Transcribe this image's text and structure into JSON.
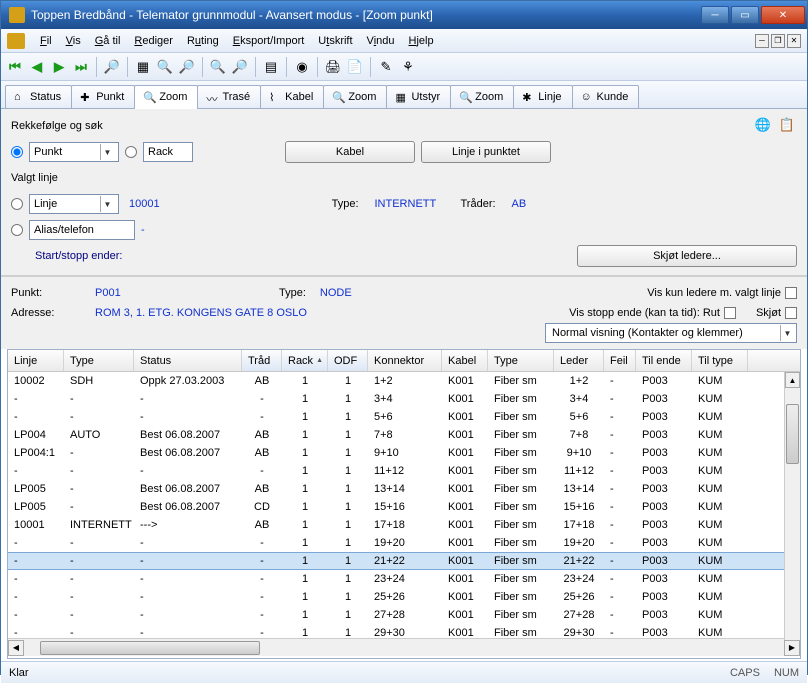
{
  "window": {
    "title": "Toppen Bredbånd - Telemator grunnmodul - Avansert modus - [Zoom punkt]"
  },
  "menu": {
    "fil": "Fil",
    "vis": "Vis",
    "gatil": "Gå til",
    "rediger": "Rediger",
    "ruting": "Ruting",
    "eksport": "Eksport/Import",
    "utskrift": "Utskrift",
    "vindu": "Vindu",
    "hjelp": "Hjelp"
  },
  "tabs": [
    {
      "icon": "home",
      "label": "Status"
    },
    {
      "icon": "plus",
      "label": "Punkt"
    },
    {
      "icon": "zoom",
      "label": "Zoom",
      "active": true
    },
    {
      "icon": "path",
      "label": "Trasé"
    },
    {
      "icon": "cable",
      "label": "Kabel"
    },
    {
      "icon": "zoom",
      "label": "Zoom"
    },
    {
      "icon": "equip",
      "label": "Utstyr"
    },
    {
      "icon": "zoom",
      "label": "Zoom"
    },
    {
      "icon": "line",
      "label": "Linje"
    },
    {
      "icon": "cust",
      "label": "Kunde"
    }
  ],
  "form": {
    "order_label": "Rekkefølge og søk",
    "punkt_opt": "Punkt",
    "rack_opt": "Rack",
    "btn_kabel": "Kabel",
    "btn_linje": "Linje i punktet",
    "valgt_label": "Valgt linje",
    "linje_opt": "Linje",
    "linje_val": "10001",
    "type_label": "Type:",
    "type_val": "INTERNETT",
    "trader_label": "Tråder:",
    "trader_val": "AB",
    "alias_opt": "Alias/telefon",
    "alias_val": "-",
    "start_label": "Start/stopp ender:",
    "btn_skjot": "Skjøt ledere..."
  },
  "info": {
    "punkt_label": "Punkt:",
    "punkt_val": "P001",
    "itype_label": "Type:",
    "itype_val": "NODE",
    "vis_kun_label": "Vis kun ledere m. valgt linje",
    "adresse_label": "Adresse:",
    "adresse_val": "ROM 3, 1. ETG. KONGENS GATE 8 OSLO",
    "vis_stopp_label": "Vis stopp ende (kan ta tid): Rut",
    "skjot_chk": "Skjøt",
    "visning_val": "Normal visning (Kontakter og klemmer)"
  },
  "grid": {
    "headers": [
      "Linje",
      "Type",
      "Status",
      "Tråd",
      "Rack",
      "ODF",
      "Konnektor",
      "Kabel",
      "Type",
      "Leder",
      "Feil",
      "Til ende",
      "Til type"
    ],
    "rows": [
      {
        "c": [
          "10002",
          "SDH",
          "Oppk 27.03.2003",
          "AB",
          "1",
          "1",
          "1+2",
          "K001",
          "Fiber sm",
          "1+2",
          "-",
          "P003",
          "KUM"
        ]
      },
      {
        "c": [
          "-",
          "-",
          "-",
          "-",
          "1",
          "1",
          "3+4",
          "K001",
          "Fiber sm",
          "3+4",
          "-",
          "P003",
          "KUM"
        ]
      },
      {
        "c": [
          "-",
          "-",
          "-",
          "-",
          "1",
          "1",
          "5+6",
          "K001",
          "Fiber sm",
          "5+6",
          "-",
          "P003",
          "KUM"
        ]
      },
      {
        "c": [
          "LP004",
          "AUTO",
          "Best 06.08.2007",
          "AB",
          "1",
          "1",
          "7+8",
          "K001",
          "Fiber sm",
          "7+8",
          "-",
          "P003",
          "KUM"
        ]
      },
      {
        "c": [
          "LP004:1",
          "-",
          "Best 06.08.2007",
          "AB",
          "1",
          "1",
          "9+10",
          "K001",
          "Fiber sm",
          "9+10",
          "-",
          "P003",
          "KUM"
        ]
      },
      {
        "c": [
          "-",
          "-",
          "-",
          "-",
          "1",
          "1",
          "11+12",
          "K001",
          "Fiber sm",
          "11+12",
          "-",
          "P003",
          "KUM"
        ]
      },
      {
        "c": [
          "LP005",
          "-",
          "Best 06.08.2007",
          "AB",
          "1",
          "1",
          "13+14",
          "K001",
          "Fiber sm",
          "13+14",
          "-",
          "P003",
          "KUM"
        ]
      },
      {
        "c": [
          "LP005",
          "-",
          "Best 06.08.2007",
          "CD",
          "1",
          "1",
          "15+16",
          "K001",
          "Fiber sm",
          "15+16",
          "-",
          "P003",
          "KUM"
        ]
      },
      {
        "c": [
          "10001",
          "INTERNETT",
          "--->",
          "AB",
          "1",
          "1",
          "17+18",
          "K001",
          "Fiber sm",
          "17+18",
          "-",
          "P003",
          "KUM"
        ]
      },
      {
        "c": [
          "-",
          "-",
          "-",
          "-",
          "1",
          "1",
          "19+20",
          "K001",
          "Fiber sm",
          "19+20",
          "-",
          "P003",
          "KUM"
        ]
      },
      {
        "sel": true,
        "c": [
          "-",
          "-",
          "-",
          "-",
          "1",
          "1",
          "21+22",
          "K001",
          "Fiber sm",
          "21+22",
          "-",
          "P003",
          "KUM"
        ]
      },
      {
        "c": [
          "-",
          "-",
          "-",
          "-",
          "1",
          "1",
          "23+24",
          "K001",
          "Fiber sm",
          "23+24",
          "-",
          "P003",
          "KUM"
        ]
      },
      {
        "c": [
          "-",
          "-",
          "-",
          "-",
          "1",
          "1",
          "25+26",
          "K001",
          "Fiber sm",
          "25+26",
          "-",
          "P003",
          "KUM"
        ]
      },
      {
        "c": [
          "-",
          "-",
          "-",
          "-",
          "1",
          "1",
          "27+28",
          "K001",
          "Fiber sm",
          "27+28",
          "-",
          "P003",
          "KUM"
        ]
      },
      {
        "c": [
          "-",
          "-",
          "-",
          "-",
          "1",
          "1",
          "29+30",
          "K001",
          "Fiber sm",
          "29+30",
          "-",
          "P003",
          "KUM"
        ]
      }
    ]
  },
  "status": {
    "left": "Klar",
    "caps": "CAPS",
    "num": "NUM"
  }
}
